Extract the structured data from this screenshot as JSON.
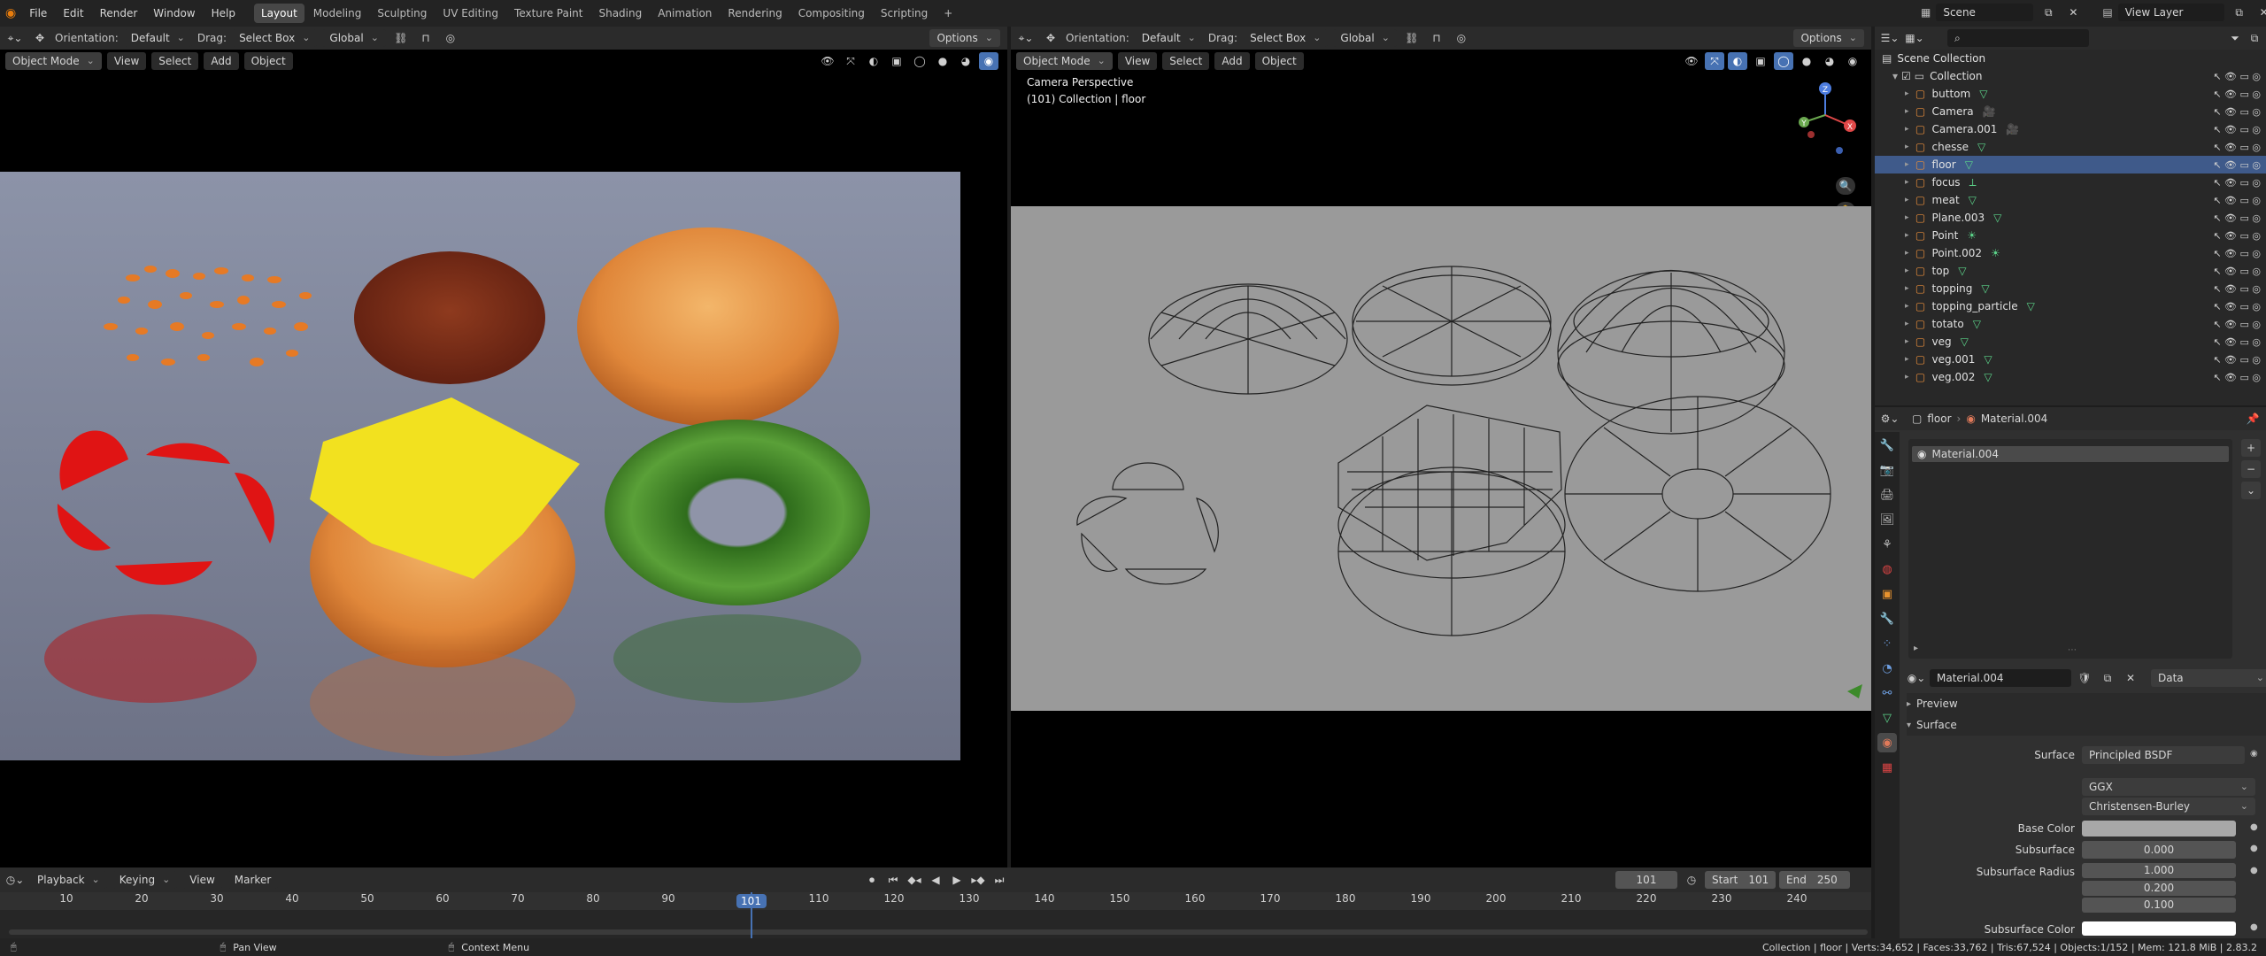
{
  "topbar": {
    "menus": [
      "File",
      "Edit",
      "Render",
      "Window",
      "Help"
    ],
    "workspaces": [
      "Layout",
      "Modeling",
      "Sculpting",
      "UV Editing",
      "Texture Paint",
      "Shading",
      "Animation",
      "Rendering",
      "Compositing",
      "Scripting"
    ],
    "active_workspace": "Layout",
    "add_workspace": "+",
    "scene_name": "Scene",
    "view_layer": "View Layer"
  },
  "viewport_left": {
    "orientation_label": "Orientation:",
    "orientation_value": "Default",
    "drag_label": "Drag:",
    "drag_value": "Select Box",
    "transform_space": "Global",
    "options": "Options",
    "mode": "Object Mode",
    "menus": [
      "View",
      "Select",
      "Add",
      "Object"
    ]
  },
  "viewport_right": {
    "orientation_label": "Orientation:",
    "orientation_value": "Default",
    "drag_label": "Drag:",
    "drag_value": "Select Box",
    "transform_space": "Global",
    "options": "Options",
    "mode": "Object Mode",
    "menus": [
      "View",
      "Select",
      "Add",
      "Object"
    ],
    "overlay_line1": "Camera Perspective",
    "overlay_line2": "(101) Collection | floor",
    "gizmo": {
      "x": "X",
      "y": "Y",
      "z": "Z"
    }
  },
  "outliner": {
    "root": "Scene Collection",
    "collection": "Collection",
    "items": [
      {
        "name": "buttom",
        "icon": "mesh-icon",
        "selected": false
      },
      {
        "name": "Camera",
        "icon": "camera-icon",
        "selected": false
      },
      {
        "name": "Camera.001",
        "icon": "camera-icon",
        "selected": false
      },
      {
        "name": "chesse",
        "icon": "mesh-icon",
        "selected": false
      },
      {
        "name": "floor",
        "icon": "mesh-icon",
        "selected": true
      },
      {
        "name": "focus",
        "icon": "empty-icon",
        "selected": false
      },
      {
        "name": "meat",
        "icon": "mesh-icon",
        "selected": false
      },
      {
        "name": "Plane.003",
        "icon": "mesh-icon",
        "selected": false
      },
      {
        "name": "Point",
        "icon": "light-icon",
        "selected": false
      },
      {
        "name": "Point.002",
        "icon": "light-icon",
        "selected": false
      },
      {
        "name": "top",
        "icon": "mesh-icon",
        "selected": false
      },
      {
        "name": "topping",
        "icon": "mesh-icon",
        "selected": false
      },
      {
        "name": "topping_particle",
        "icon": "mesh-icon",
        "selected": false
      },
      {
        "name": "totato",
        "icon": "mesh-icon",
        "selected": false
      },
      {
        "name": "veg",
        "icon": "mesh-icon",
        "selected": false
      },
      {
        "name": "veg.001",
        "icon": "mesh-icon",
        "selected": false
      },
      {
        "name": "veg.002",
        "icon": "mesh-icon",
        "selected": false
      }
    ]
  },
  "properties": {
    "object_name": "floor",
    "material_name": "Material.004",
    "slot_name": "Material.004",
    "material_field": "Material.004",
    "link_mode": "Data",
    "preview_panel": "Preview",
    "surface_panel": "Surface",
    "surface_label": "Surface",
    "surface_value": "Principled BSDF",
    "distribution": "GGX",
    "subsurface_method": "Christensen-Burley",
    "base_color_label": "Base Color",
    "subsurface_label": "Subsurface",
    "subsurface_value": "0.000",
    "subsurface_radius_label": "Subsurface Radius",
    "subsurface_radius": [
      "1.000",
      "0.200",
      "0.100"
    ],
    "subsurface_color_label": "Subsurface Color",
    "colors": {
      "base_color": "#a8a8a8",
      "subsurface_color": "#ffffff"
    }
  },
  "timeline": {
    "menus": [
      "Playback",
      "Keying",
      "View",
      "Marker"
    ],
    "current_frame": "101",
    "start_label": "Start",
    "start_value": "101",
    "end_label": "End",
    "end_value": "250",
    "ticks": [
      "10",
      "20",
      "30",
      "40",
      "50",
      "60",
      "70",
      "80",
      "90",
      "101",
      "110",
      "120",
      "130",
      "140",
      "150",
      "160",
      "170",
      "180",
      "190",
      "200",
      "210",
      "220",
      "230",
      "240"
    ],
    "playhead_label": "101"
  },
  "statusbar": {
    "pan_view": "Pan View",
    "context_menu": "Context Menu",
    "stats": "Collection | floor | Verts:34,652 | Faces:33,762 | Tris:67,524 | Objects:1/152 | Mem: 121.8 MiB | 2.83.2"
  }
}
